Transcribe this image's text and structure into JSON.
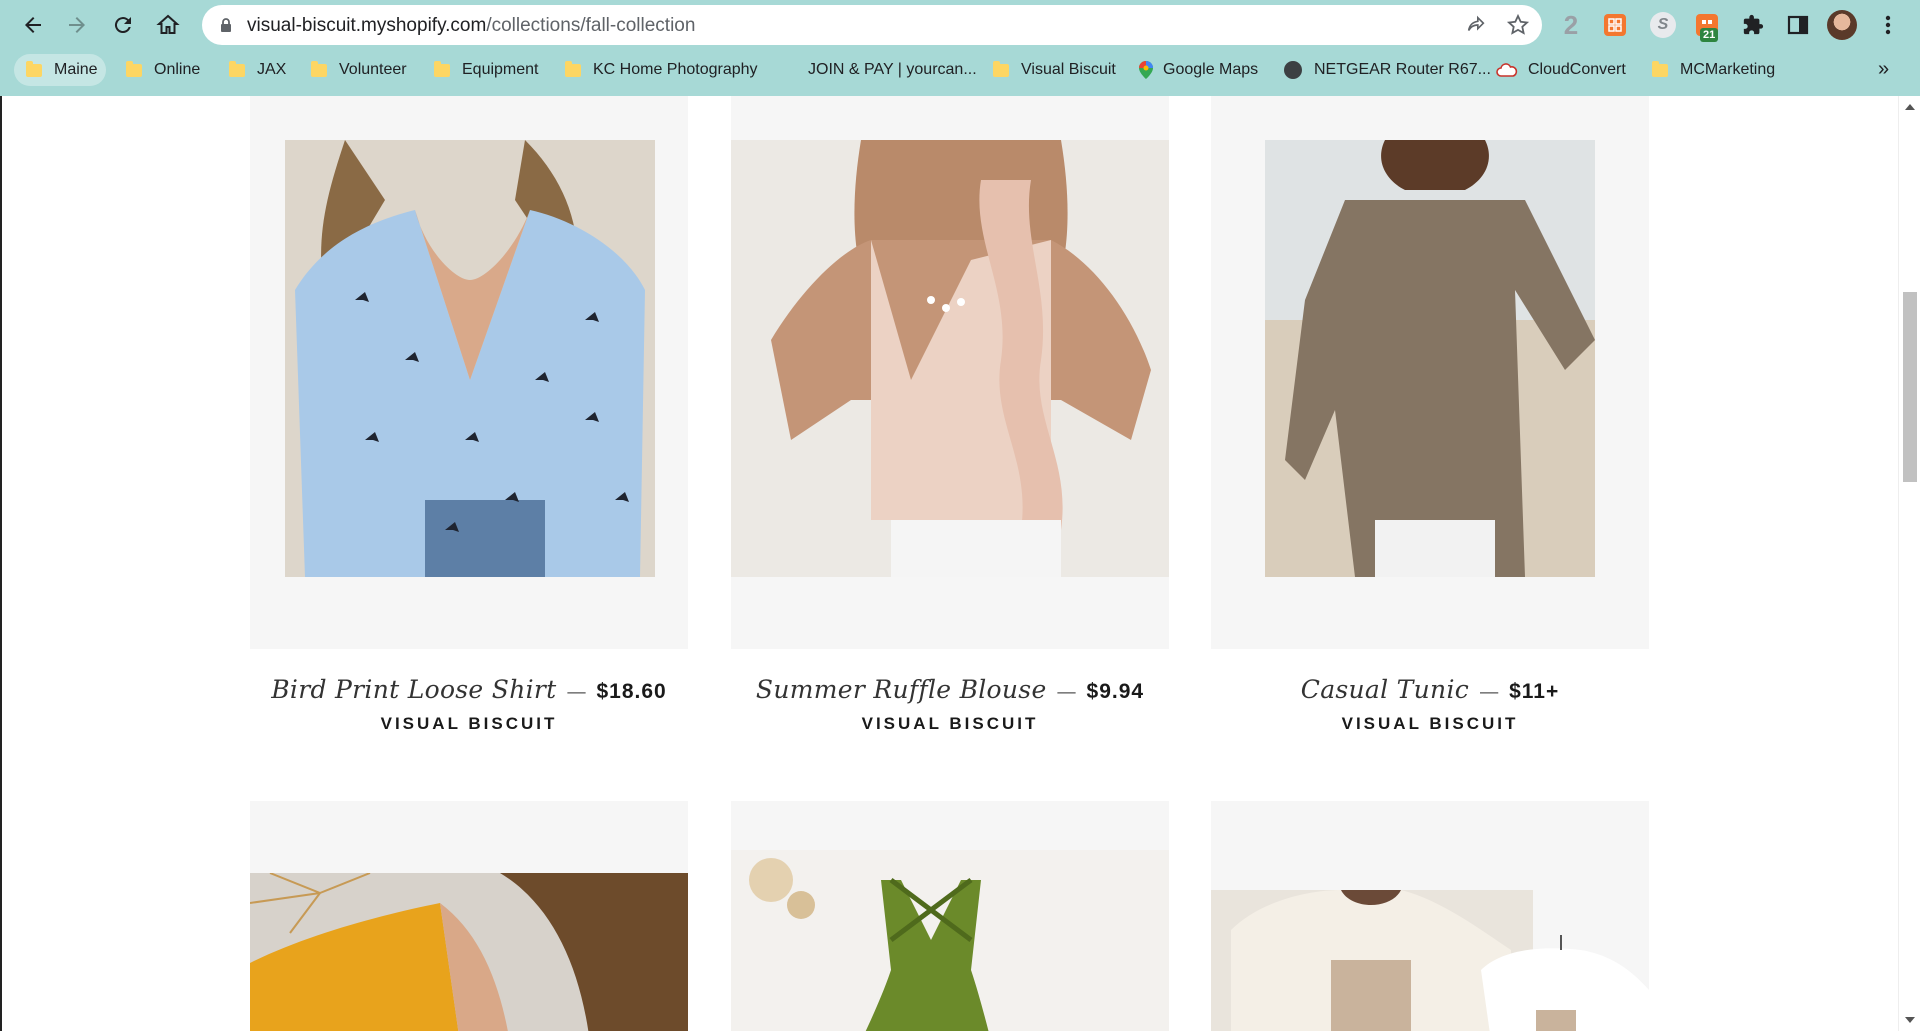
{
  "browser": {
    "url_host": "visual-biscuit.myshopify.com",
    "url_path": "/collections/fall-collection",
    "extension_badge": "21",
    "extension_two_label": "2",
    "extension_s_label": "S"
  },
  "bookmarks": [
    {
      "label": "Maine",
      "icon": "folder-icon"
    },
    {
      "label": "Online",
      "icon": "folder-icon"
    },
    {
      "label": "JAX",
      "icon": "folder-icon"
    },
    {
      "label": "Volunteer",
      "icon": "folder-icon"
    },
    {
      "label": "Equipment",
      "icon": "folder-icon"
    },
    {
      "label": "KC Home Photography",
      "icon": "folder-icon"
    },
    {
      "label": "JOIN & PAY | yourcan...",
      "icon": "none"
    },
    {
      "label": "Visual Biscuit",
      "icon": "folder-icon"
    },
    {
      "label": "Google Maps",
      "icon": "map-pin-icon"
    },
    {
      "label": "NETGEAR Router R67...",
      "icon": "globe-icon"
    },
    {
      "label": "CloudConvert",
      "icon": "cloud-icon"
    },
    {
      "label": "MCMarketing",
      "icon": "folder-icon"
    }
  ],
  "bookmarks_more": "»",
  "products": [
    {
      "title": "Bird Print Loose Shirt",
      "price": "$18.60",
      "vendor": "VISUAL BISCUIT"
    },
    {
      "title": "Summer Ruffle Blouse",
      "price": "$9.94",
      "vendor": "VISUAL BISCUIT"
    },
    {
      "title": "Casual Tunic",
      "price": "$11+",
      "vendor": "VISUAL BISCUIT"
    }
  ],
  "separator": "—",
  "colors": {
    "chrome_bg": "#a7d9d6",
    "image_bg": "#f6f6f6",
    "shirt_blue": "#a9c9e8",
    "blouse_pink": "#ecd2c4",
    "tunic_brown": "#857563",
    "sweater_yellow": "#e8a31c",
    "top_green": "#6b8a2a"
  }
}
